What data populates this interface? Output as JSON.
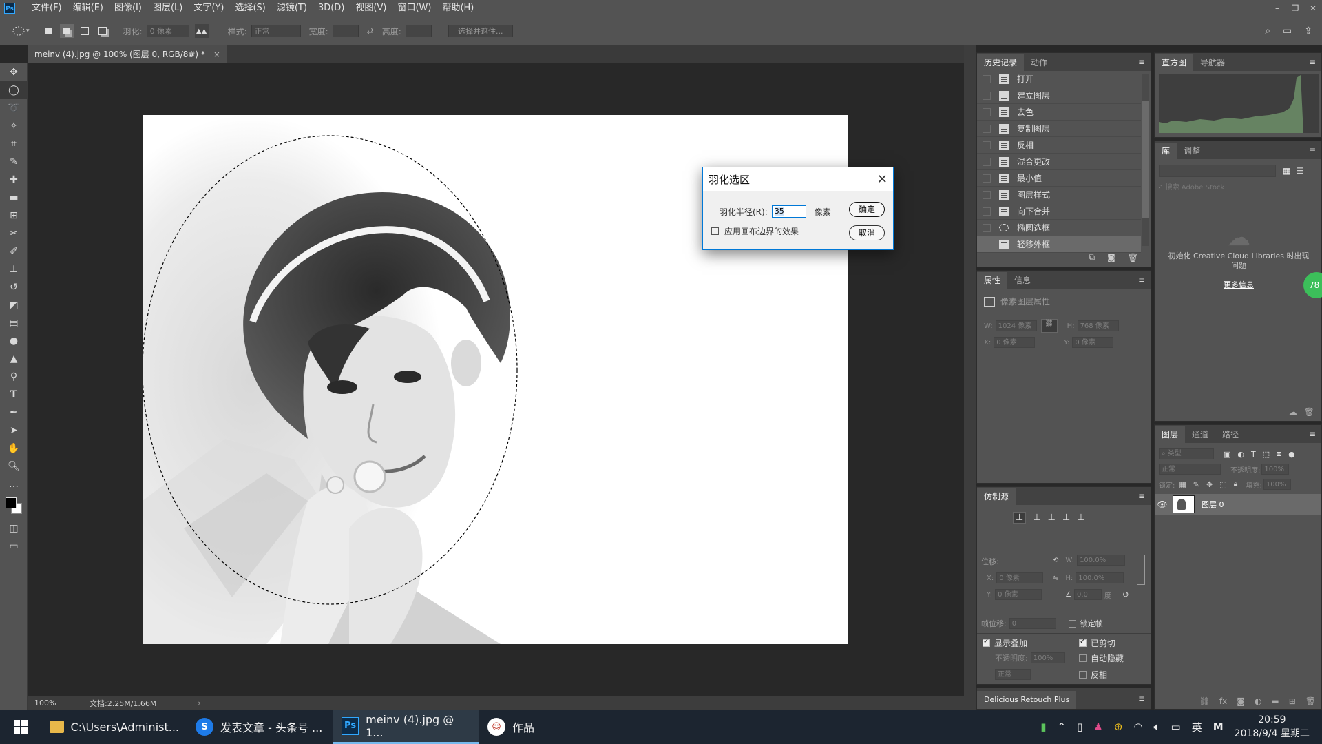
{
  "app": {
    "logo": "Ps"
  },
  "menu": [
    "文件(F)",
    "编辑(E)",
    "图像(I)",
    "图层(L)",
    "文字(Y)",
    "选择(S)",
    "滤镜(T)",
    "3D(D)",
    "视图(V)",
    "窗口(W)",
    "帮助(H)"
  ],
  "options": {
    "feather_label": "羽化:",
    "feather_value": "0 像素",
    "style_label": "样式:",
    "style_value": "正常",
    "width_label": "宽度:",
    "height_label": "高度:",
    "select_mask_btn": "选择并遮住..."
  },
  "document": {
    "tab_title": "meinv (4).jpg @ 100% (图层 0, RGB/8#) *",
    "zoom": "100%",
    "doc_info": "文档:2.25M/1.66M"
  },
  "history_panel": {
    "tabs": [
      "历史记录",
      "动作"
    ],
    "items": [
      "打开",
      "建立图层",
      "去色",
      "复制图层",
      "反相",
      "混合更改",
      "最小值",
      "图层样式",
      "向下合并",
      "椭圆选框",
      "轻移外框"
    ],
    "selected_index": 10
  },
  "properties_panel": {
    "tabs": [
      "属性",
      "信息"
    ],
    "header": "像素图层属性",
    "w_label": "W:",
    "w_value": "1024 像素",
    "h_label": "H:",
    "h_value": "768 像素",
    "x_label": "X:",
    "x_value": "0 像素",
    "y_label": "Y:",
    "y_value": "0 像素"
  },
  "clone_panel": {
    "title": "仿制源",
    "offset_label": "位移:",
    "x_label": "X:",
    "x_value": "0 像素",
    "y_label": "Y:",
    "y_value": "0 像素",
    "w_label": "W:",
    "w_value": "100.0%",
    "h_label": "H:",
    "h_value": "100.0%",
    "angle_value": "0.0",
    "angle_unit": "度",
    "frame_offset_label": "帧位移:",
    "frame_offset_value": "0",
    "lock_frame_label": "锁定帧",
    "show_overlay_label": "显示叠加",
    "clipped_label": "已剪切",
    "opacity_label": "不透明度:",
    "opacity_value": "100%",
    "auto_hide_label": "自动隐藏",
    "blend_value": "正常",
    "invert_label": "反相"
  },
  "drp_panel": {
    "title": "Delicious Retouch Plus"
  },
  "histogram_panel": {
    "tabs": [
      "直方图",
      "导航器"
    ]
  },
  "library_panel": {
    "tabs": [
      "库",
      "调整"
    ],
    "search_placeholder": "搜索 Adobe Stock",
    "init_msg": "初始化 Creative Cloud Libraries 时出现问题",
    "more_info": "更多信息",
    "badge": "78"
  },
  "layers_panel": {
    "tabs": [
      "图层",
      "通道",
      "路径"
    ],
    "filter_label": "类型",
    "blend_mode": "正常",
    "opacity_label": "不透明度:",
    "opacity_value": "100%",
    "lock_label": "锁定:",
    "fill_label": "填充:",
    "fill_value": "100%",
    "layers": [
      {
        "name": "图层 0",
        "visible": true
      }
    ]
  },
  "dialog": {
    "title": "羽化选区",
    "radius_label": "羽化半径(R):",
    "radius_value": "35",
    "unit": "像素",
    "ok": "确定",
    "cancel": "取消",
    "apply_canvas_label": "应用画布边界的效果"
  },
  "taskbar": {
    "items": [
      {
        "label": "C:\\Users\\Administ...",
        "icon": "folder-icon"
      },
      {
        "label": "发表文章 - 头条号 ...",
        "icon": "sogou-browser-icon"
      },
      {
        "label": "meinv (4).jpg @ 1...",
        "icon": "photoshop-icon"
      },
      {
        "label": "作品",
        "icon": "app-icon"
      }
    ],
    "time": "20:59",
    "date": "2018/9/4 星期二",
    "ime": "英"
  },
  "colors": {
    "accent": "#0078d7",
    "panel": "#535353",
    "canvas_bg": "#282828",
    "taskbar": "#1c2530"
  }
}
